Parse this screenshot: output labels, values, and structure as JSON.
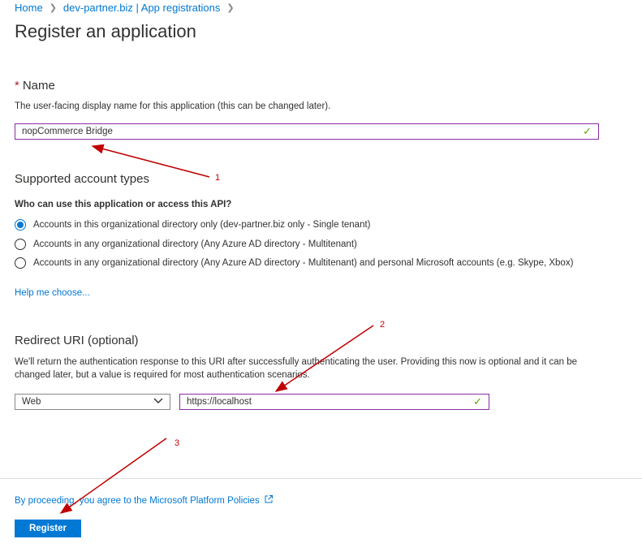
{
  "breadcrumb": {
    "home": "Home",
    "parent": "dev-partner.biz | App registrations"
  },
  "page_title": "Register an application",
  "name_section": {
    "required_marker": "*",
    "label": "Name",
    "description": "The user-facing display name for this application (this can be changed later).",
    "value": "nopCommerce Bridge"
  },
  "account_types": {
    "heading": "Supported account types",
    "question": "Who can use this application or access this API?",
    "options": [
      {
        "label": "Accounts in this organizational directory only (dev-partner.biz only - Single tenant)",
        "selected": true
      },
      {
        "label": "Accounts in any organizational directory (Any Azure AD directory - Multitenant)",
        "selected": false
      },
      {
        "label": "Accounts in any organizational directory (Any Azure AD directory - Multitenant) and personal Microsoft accounts (e.g. Skype, Xbox)",
        "selected": false
      }
    ],
    "help_link": "Help me choose..."
  },
  "redirect_uri": {
    "heading": "Redirect URI (optional)",
    "description_line1": "We'll return the authentication response to this URI after successfully authenticating the user. Providing this now is optional and it can be",
    "description_line2": "changed later, but a value is required for most authentication scenarios.",
    "platform_value": "Web",
    "uri_value": "https://localhost"
  },
  "footer": {
    "policy_text": "By proceeding, you agree to the Microsoft Platform Policies",
    "register_label": "Register"
  },
  "annotations": {
    "one": "1",
    "two": "2",
    "three": "3"
  },
  "colors": {
    "accent": "#0078d4",
    "input_focus_border": "#8a2da5",
    "valid_check": "#57a300",
    "annotation_red": "#c00000",
    "required_red": "#a4262c"
  }
}
